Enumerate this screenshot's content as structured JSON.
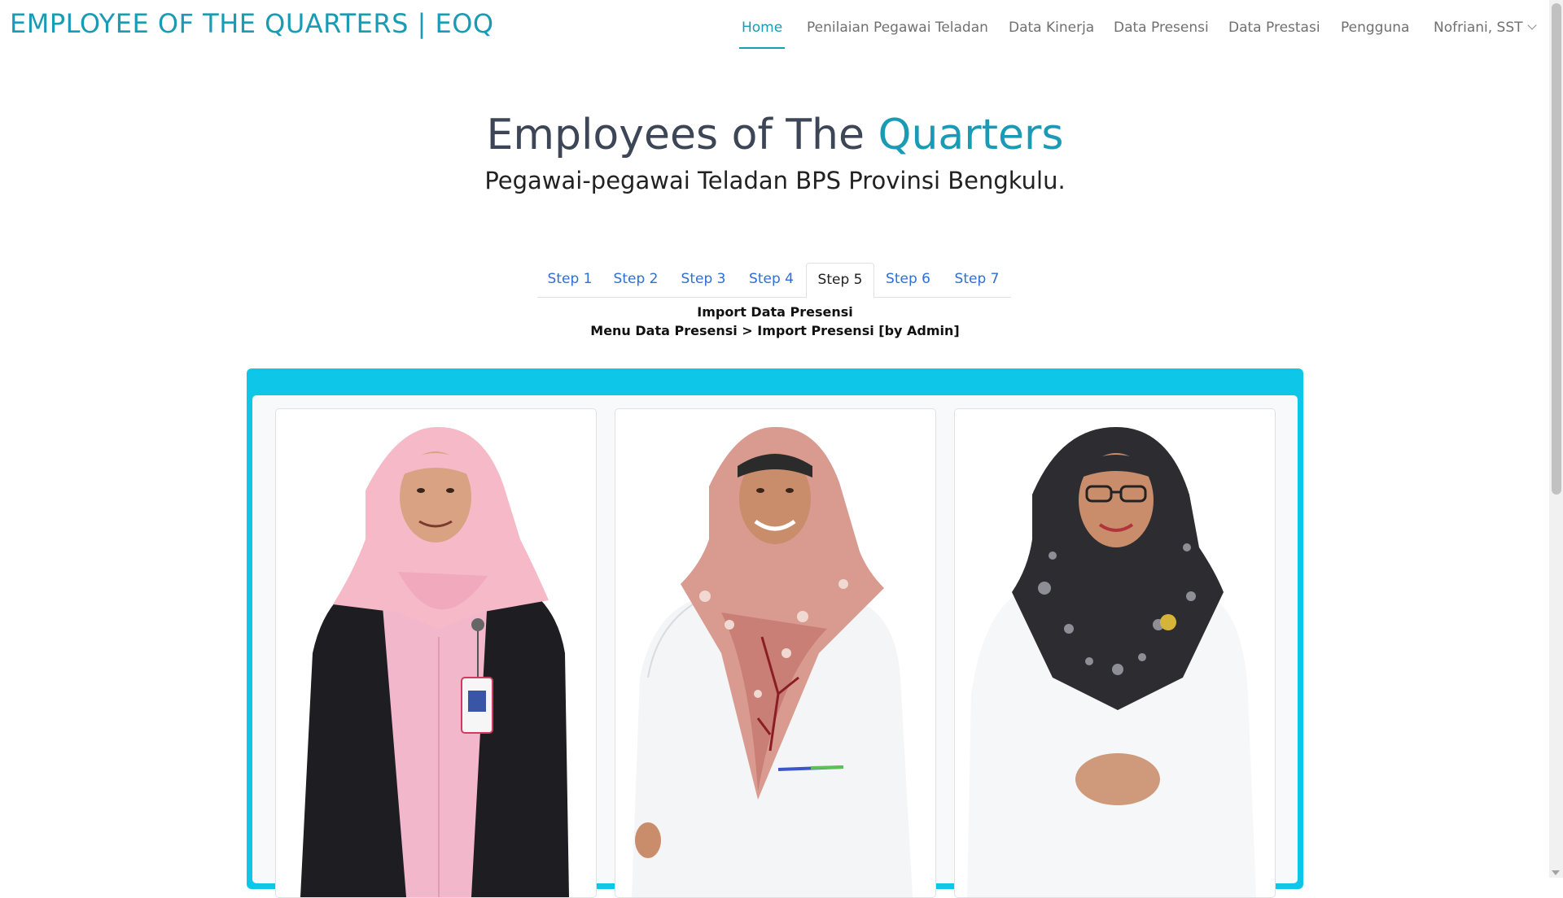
{
  "brand": "EMPLOYEE OF THE QUARTERS | EOQ",
  "nav": {
    "items": [
      {
        "label": "Home",
        "active": true
      },
      {
        "label": "Penilaian Pegawai Teladan",
        "active": false
      },
      {
        "label": "Data Kinerja",
        "active": false
      },
      {
        "label": "Data Presensi",
        "active": false
      },
      {
        "label": "Data Prestasi",
        "active": false
      },
      {
        "label": "Pengguna",
        "active": false
      }
    ],
    "user": "Nofriani, SST"
  },
  "hero": {
    "title_main": "Employees of The ",
    "title_accent": "Quarters",
    "subtitle": "Pegawai-pegawai Teladan BPS Provinsi Bengkulu."
  },
  "tabs": {
    "items": [
      "Step 1",
      "Step 2",
      "Step 3",
      "Step 4",
      "Step 5",
      "Step 6",
      "Step 7"
    ],
    "active_index": 4
  },
  "step": {
    "title": "Import Data Presensi",
    "description": "Menu Data Presensi > Import Presensi [by Admin]"
  },
  "colors": {
    "accent": "#1a9bb5",
    "panel": "#0ec6e8",
    "tab_link": "#2f6fd6"
  },
  "cards": [
    {
      "icon": "employee-photo-pink-hijab"
    },
    {
      "icon": "employee-photo-floral-hijab"
    },
    {
      "icon": "employee-photo-black-hijab"
    }
  ]
}
